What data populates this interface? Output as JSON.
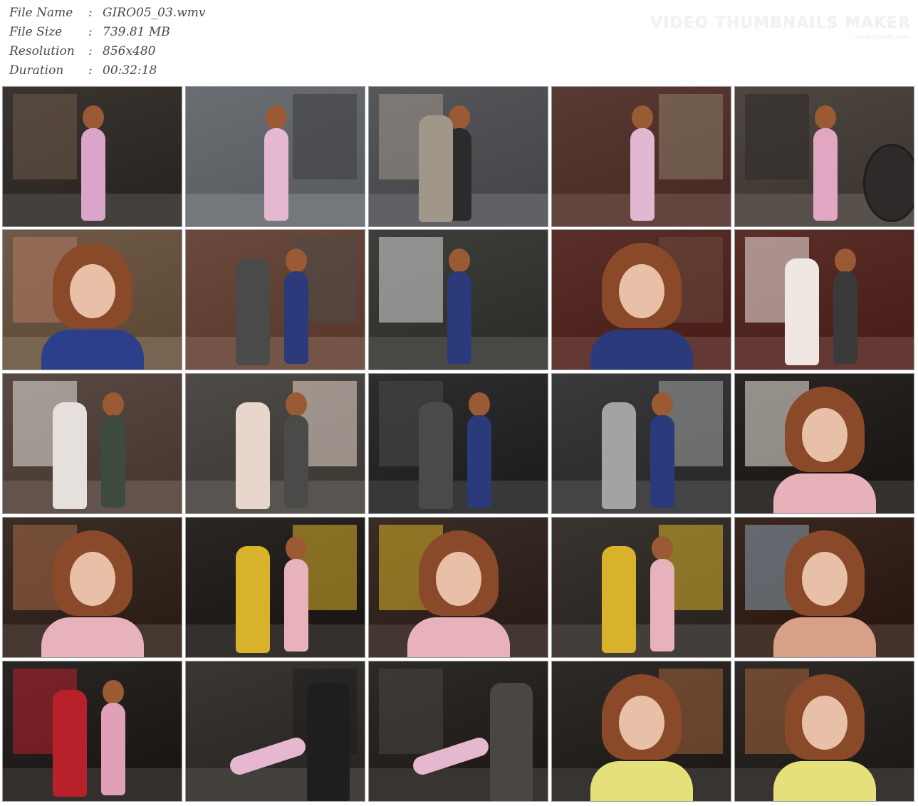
{
  "file_info": [
    {
      "label": "File Name",
      "sep": ":",
      "value": "GIRO05_03.wmv"
    },
    {
      "label": "File Size",
      "sep": ":",
      "value": "739.81 MB"
    },
    {
      "label": "Resolution",
      "sep": ":",
      "value": "856x480"
    },
    {
      "label": "Duration",
      "sep": ":",
      "value": "00:32:18"
    }
  ],
  "watermark": {
    "title": "VIDEO THUMBNAILS MAKER",
    "subtitle": "www.idpsoft.com"
  },
  "thumbnails": [
    {
      "bg": "#3a3530",
      "accent": "#d9a6c9",
      "second": "#6d5a4a",
      "kind": "standing"
    },
    {
      "bg": "#6a6e72",
      "accent": "#e6b8cf",
      "second": "#3c3c40",
      "kind": "standing"
    },
    {
      "bg": "#55575a",
      "accent": "#2b2b2b",
      "second": "#a0968a",
      "kind": "crowd"
    },
    {
      "bg": "#5a3a34",
      "accent": "#e2b7d2",
      "second": "#8a7d6a",
      "kind": "standing"
    },
    {
      "bg": "#4e4741",
      "accent": "#e0a6c2",
      "second": "#2e2a2a",
      "kind": "fan"
    },
    {
      "bg": "#6f5a48",
      "accent": "#2c3f8a",
      "second": "#b57a64",
      "kind": "closeup"
    },
    {
      "bg": "#6b4a3e",
      "accent": "#2a3a7a",
      "second": "#4a4a48",
      "kind": "pair"
    },
    {
      "bg": "#3e3e3a",
      "accent": "#2a3a7a",
      "second": "#d8d8d8",
      "kind": "standing"
    },
    {
      "bg": "#5a2f2a",
      "accent": "#2a3a7a",
      "second": "#6c4a3c",
      "kind": "closeup"
    },
    {
      "bg": "#5a2f2a",
      "accent": "#3a3a3a",
      "second": "#f0e6e2",
      "kind": "pair"
    },
    {
      "bg": "#584a42",
      "accent": "#3f4a3f",
      "second": "#e6e0dc",
      "kind": "pair"
    },
    {
      "bg": "#4e4a46",
      "accent": "#4a4a48",
      "second": "#e8d6cc",
      "kind": "pair"
    },
    {
      "bg": "#2e2e30",
      "accent": "#2a3a7a",
      "second": "#4a4a48",
      "kind": "pair"
    },
    {
      "bg": "#3a3a3c",
      "accent": "#2a3a7a",
      "second": "#a3a3a3",
      "kind": "pair"
    },
    {
      "bg": "#2a2624",
      "accent": "#e8b0b8",
      "second": "#eeeae0",
      "kind": "closeup"
    },
    {
      "bg": "#3a2e26",
      "accent": "#e8b2bc",
      "second": "#a76a48",
      "kind": "closeup"
    },
    {
      "bg": "#2a2624",
      "accent": "#e8b2bc",
      "second": "#d8b22a",
      "kind": "pair"
    },
    {
      "bg": "#3a2c26",
      "accent": "#e8b2bc",
      "second": "#d8b22a",
      "kind": "closeup"
    },
    {
      "bg": "#3a3430",
      "accent": "#e8b2bc",
      "second": "#d8b22a",
      "kind": "pair"
    },
    {
      "bg": "#3a2820",
      "accent": "#d9a088",
      "second": "#8aa0b0",
      "kind": "closeup"
    },
    {
      "bg": "#2a2624",
      "accent": "#e0a0b8",
      "second": "#b8202a",
      "kind": "pair"
    },
    {
      "bg": "#3a3632",
      "accent": "#e6b8cf",
      "second": "#1e1e1e",
      "kind": "lying"
    },
    {
      "bg": "#2e2a28",
      "accent": "#e6b8cf",
      "second": "#4a4642",
      "kind": "lying"
    },
    {
      "bg": "#2e2a28",
      "accent": "#e6e07a",
      "second": "#a6623a",
      "kind": "portrait"
    },
    {
      "bg": "#2e2a28",
      "accent": "#e6e07a",
      "second": "#a6623a",
      "kind": "portrait"
    }
  ]
}
